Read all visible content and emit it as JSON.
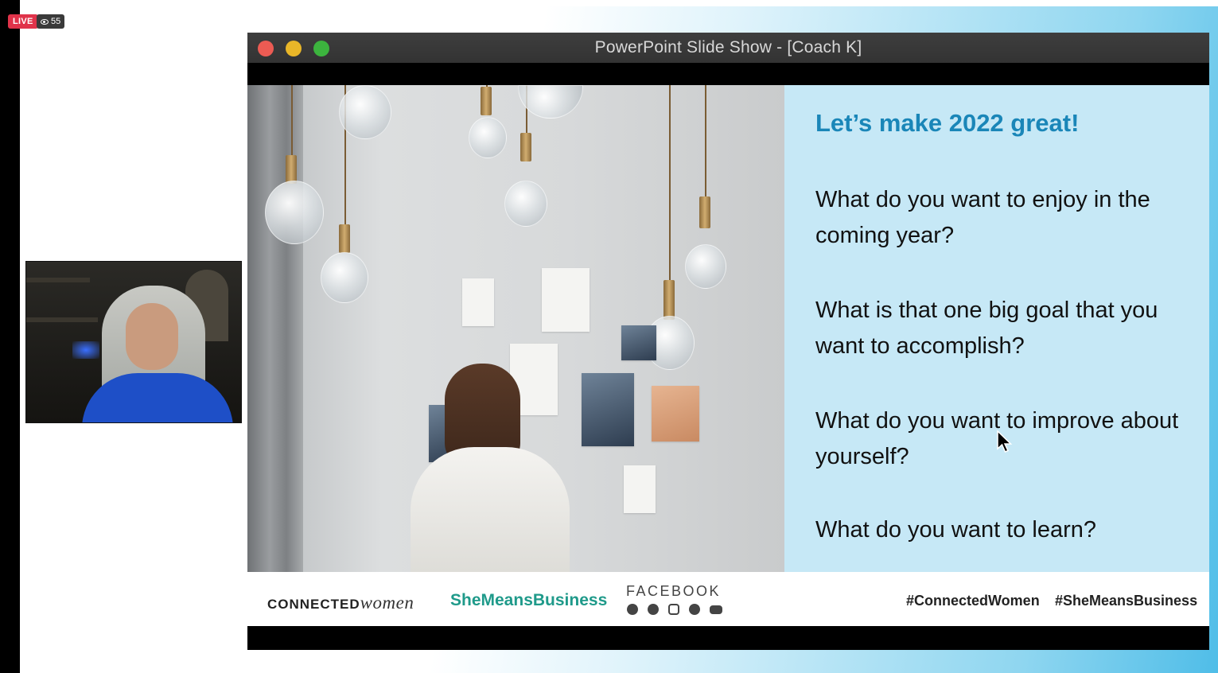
{
  "stream": {
    "live_label": "LIVE",
    "viewer_count": "55"
  },
  "window": {
    "title": "PowerPoint Slide Show - [Coach K]"
  },
  "slide": {
    "heading": "Let’s make 2022 great!",
    "questions": [
      "What do you want to enjoy in the coming year?",
      "What is that one big goal that you want to accomplish?",
      "What do you want to improve about yourself?",
      "What do you want to learn?"
    ]
  },
  "footer": {
    "brand_main": "CONNECTED",
    "brand_script": "women",
    "brand_secondary": "SheMeansBusiness",
    "facebook_label": "FACEBOOK",
    "social_icons": [
      "facebook-icon",
      "messenger-icon",
      "instagram-icon",
      "whatsapp-icon",
      "youtube-icon"
    ],
    "hashtags": [
      "#ConnectedWomen",
      "#SheMeansBusiness"
    ]
  },
  "colors": {
    "live_red": "#e0334a",
    "heading_blue": "#1a86b8",
    "panel_bg": "#c6e8f6",
    "brand_teal": "#1f9a8a"
  }
}
